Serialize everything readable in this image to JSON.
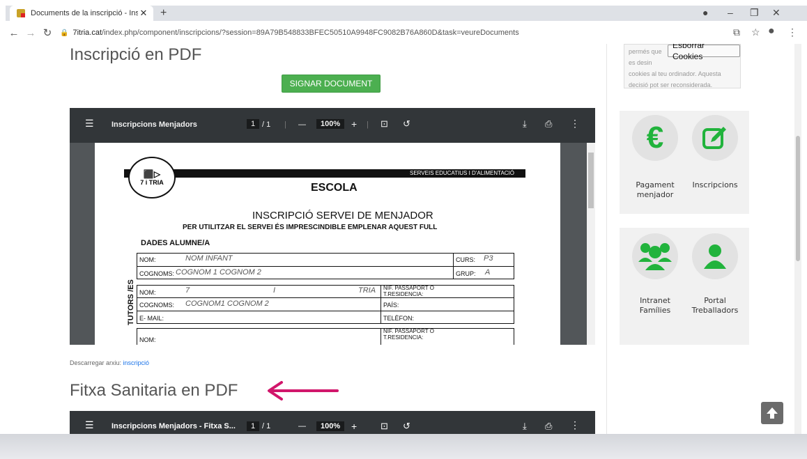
{
  "browser": {
    "tab_title": "Documents de la inscripció - Insc",
    "tab_close": "✕",
    "new_tab": "+",
    "url_host": "7itria.cat",
    "url_path": "/index.php/component/inscripcions/?session=89A79B548833BFEC50510A9948FC9082B76A860D&task=veureDocuments"
  },
  "main": {
    "title": "Inscripció en PDF",
    "sign_button": "SIGNAR DOCUMENT",
    "download_prefix": "Descarregar arxiu:",
    "download_link": "inscripció",
    "title2": "Fitxa Sanitaria en PDF"
  },
  "viewer": {
    "doc_title": "Inscripcions Menjadors",
    "page_current": "1",
    "page_sep": "/ 1",
    "zoom": "100%",
    "minus": "—",
    "plus": "+"
  },
  "viewer2": {
    "doc_title": "Inscripcions Menjadors - Fitxa S...",
    "page_current": "1",
    "page_sep": "/ 1",
    "zoom": "100%",
    "minus": "—",
    "plus": "+"
  },
  "pdf": {
    "logo_text": "7 i TRIA",
    "band_text": "SERVEIS EDUCATIUS I D'ALIMENTACIÓ",
    "school": "ESCOLA",
    "heading": "INSCRIPCIÓ SERVEI DE MENJADOR",
    "subheading": "PER UTILITZAR EL SERVEI ÉS IMPRESCINDIBLE EMPLENAR AQUEST FULL",
    "section_student": "DADES ALUMNE/A",
    "nom_label": "NOM:",
    "nom_value": "NOM INFANT",
    "curs_label": "CURS:",
    "curs_value": "P3",
    "cognoms_label": "COGNOMS:",
    "cognoms_value": "COGNOM 1 COGNOM 2",
    "grup_label": "GRUP:",
    "grup_value": "A",
    "tutor_vertical": "TUTORS /ES",
    "tutor_vertical_extra": "S",
    "t_nom_label": "NOM:",
    "t_nom_v1": "7",
    "t_nom_v2": "I",
    "t_nom_v3": "TRIA",
    "nif_label": "NIF. PASSAPORT O T.RESIDENCIA:",
    "t_cognoms_label": "COGNOMS:",
    "t_cognoms_value": "COGNOM1 COGNOM 2",
    "pais_label": "PAÍS:",
    "email_label": "E- MAIL:",
    "telefon_label": "TELÈFON:",
    "t2_nom_label": "NOM:",
    "nif2_label": "NIF. PASSAPORT O T.RESIDENCIA:"
  },
  "sidebar": {
    "cookies_text_1": "permés que",
    "cookies_text_2": "es desin",
    "cookies_text_3": "cookies al teu ordinador. Aquesta",
    "cookies_text_4": "decisió pot ser reconsiderada.",
    "cookies_button": "Esborrar Cookies",
    "widget1": [
      {
        "label_1": "Pagament",
        "label_2": "menjador",
        "icon": "euro-icon"
      },
      {
        "label_1": "Inscripcions",
        "label_2": "",
        "icon": "edit-icon"
      }
    ],
    "widget2": [
      {
        "label_1": "Intranet",
        "label_2": "Famílies",
        "icon": "group-icon"
      },
      {
        "label_1": "Portal",
        "label_2": "Treballadors",
        "icon": "user-icon"
      }
    ]
  },
  "colors": {
    "accent_green": "#4caf50",
    "icon_green": "#21b33c",
    "arrow_magenta": "#d1166b"
  }
}
